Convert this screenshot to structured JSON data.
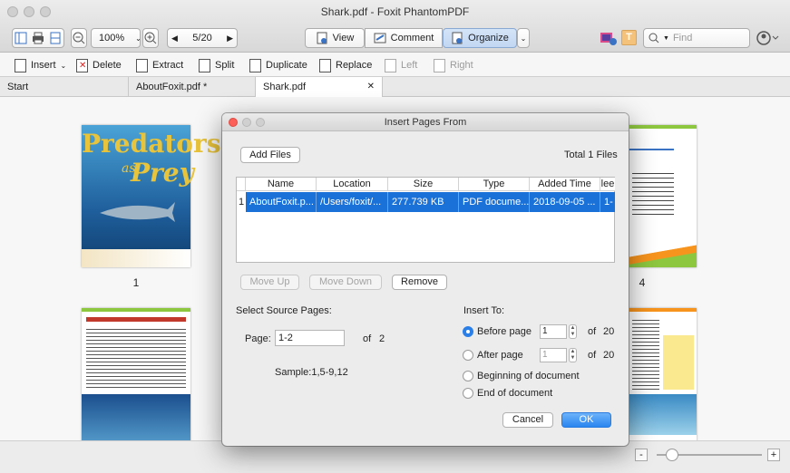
{
  "window": {
    "title": "Shark.pdf - Foxit PhantomPDF"
  },
  "toolbar": {
    "zoom": "100%",
    "page_indicator": "5/20",
    "view_label": "View",
    "comment_label": "Comment",
    "organize_label": "Organize",
    "find_placeholder": "Find"
  },
  "organize_toolbar": {
    "insert": "Insert",
    "delete": "Delete",
    "extract": "Extract",
    "split": "Split",
    "duplicate": "Duplicate",
    "replace": "Replace",
    "left": "Left",
    "right": "Right"
  },
  "tabs": [
    {
      "label": "Start"
    },
    {
      "label": "AboutFoxit.pdf *"
    },
    {
      "label": "Shark.pdf",
      "close": "✕"
    }
  ],
  "thumbnails": {
    "page1_title1": "Predators",
    "page1_title2": "as",
    "page1_title3": "Prey",
    "page1_number": "1",
    "page4_number": "4"
  },
  "dialog": {
    "title": "Insert Pages From",
    "add_files": "Add Files",
    "total_files": "Total 1 Files",
    "columns": [
      "Name",
      "Location",
      "Size",
      "Type",
      "Added Time",
      "lee"
    ],
    "row": {
      "index": "1",
      "name": "AboutFoxit.p...",
      "location": "/Users/foxit/...",
      "size": "277.739 KB",
      "type": "PDF docume...",
      "added": "2018-09-05 ...",
      "extra": "1-"
    },
    "move_up": "Move Up",
    "move_down": "Move Down",
    "remove": "Remove",
    "select_source": "Select Source Pages:",
    "page_label": "Page:",
    "page_value": "1-2",
    "of_label": "of",
    "source_total": "2",
    "sample": "Sample:1,5-9,12",
    "insert_to": "Insert To:",
    "before_page": "Before page",
    "after_page": "After page",
    "beginning": "Beginning of document",
    "end": "End of document",
    "before_value": "1",
    "after_value": "1",
    "before_total": "20",
    "after_total": "20",
    "cancel": "Cancel",
    "ok": "OK"
  },
  "statusbar": {
    "minus": "-",
    "plus": "+"
  },
  "colors": {
    "accent": "#2b7fe8",
    "selection": "#1a72d9"
  }
}
